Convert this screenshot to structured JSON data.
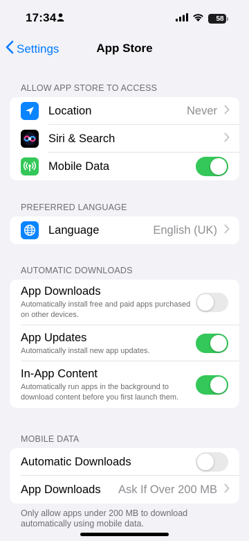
{
  "status_bar": {
    "time": "17:34",
    "battery": "58"
  },
  "nav": {
    "back_label": "Settings",
    "title": "App Store"
  },
  "access_section": {
    "header": "ALLOW APP STORE TO ACCESS",
    "location": {
      "label": "Location",
      "value": "Never",
      "icon": "location-arrow-icon",
      "icon_color": "#0a84ff"
    },
    "siri": {
      "label": "Siri & Search",
      "icon": "siri-icon"
    },
    "mobile_data": {
      "label": "Mobile Data",
      "toggle": true,
      "icon": "antenna-icon",
      "icon_color": "#34c759"
    }
  },
  "language_section": {
    "header": "PREFERRED LANGUAGE",
    "language": {
      "label": "Language",
      "value": "English (UK)",
      "icon": "globe-icon",
      "icon_color": "#0a84ff"
    }
  },
  "auto_downloads_section": {
    "header": "AUTOMATIC DOWNLOADS",
    "app_downloads": {
      "label": "App Downloads",
      "description": "Automatically install free and paid apps purchased on other devices.",
      "toggle": false
    },
    "app_updates": {
      "label": "App Updates",
      "description": "Automatically install new app updates.",
      "toggle": true
    },
    "in_app_content": {
      "label": "In-App Content",
      "description": "Automatically run apps in the background to download content before you first launch them.",
      "toggle": true
    }
  },
  "mobile_data_section": {
    "header": "MOBILE DATA",
    "automatic_downloads": {
      "label": "Automatic Downloads",
      "toggle": false
    },
    "app_downloads": {
      "label": "App Downloads",
      "value": "Ask If Over 200 MB"
    },
    "footer": "Only allow apps under 200 MB to download automatically using mobile data."
  },
  "colors": {
    "accent": "#007aff",
    "toggle_on": "#34c759"
  }
}
